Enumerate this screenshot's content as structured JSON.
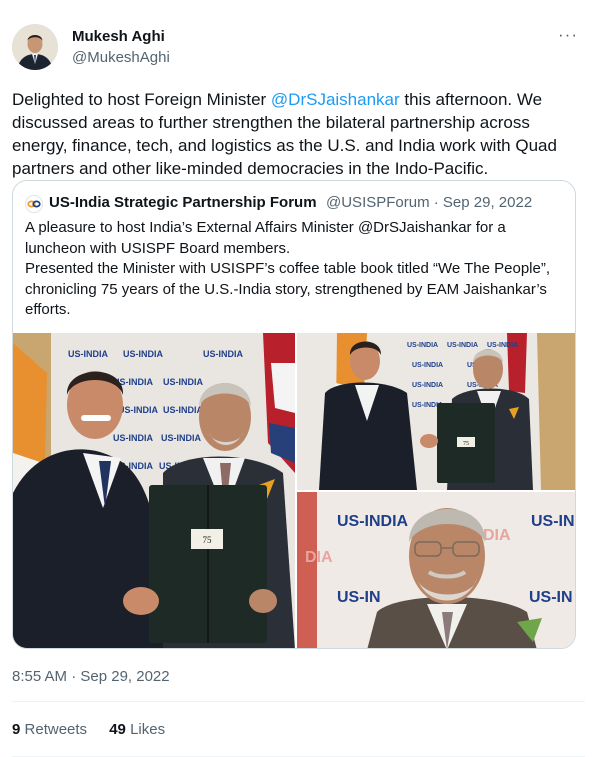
{
  "author": {
    "display_name": "Mukesh Aghi",
    "handle": "@MukeshAghi"
  },
  "menu": {
    "more_label": "···"
  },
  "tweet": {
    "text_before": "Delighted to host Foreign Minister ",
    "mention": "@DrSJaishankar",
    "text_after": " this afternoon. We discussed areas to further strengthen the bilateral partnership across energy, finance, tech, and logistics as the U.S. and India work with Quad partners and other like-minded democracies in the Indo-Pacific."
  },
  "quote": {
    "display_name": "US-India Strategic Partnership Forum",
    "meta": "@USISPForum · Sep 29, 2022",
    "line1": "A pleasure to host India’s External Affairs Minister @DrSJaishankar for a luncheon with USISPF Board members.",
    "line2": "Presented the Minister with USISPF’s coffee table book titled “We The People”, chronicling 75 years of the U.S.-India story, strengthened by EAM Jaishankar’s efforts.",
    "images": [
      {
        "backdrop_text": "US-INDIA",
        "book_label": "75"
      },
      {
        "backdrop_text": "US-INDIA",
        "book_label": "75"
      },
      {
        "backdrop_text": "US-INDIA"
      }
    ]
  },
  "timestamp": "8:55 AM · Sep 29, 2022",
  "stats": {
    "retweets_count": "9",
    "retweets_label": "Retweets",
    "likes_count": "49",
    "likes_label": "Likes"
  },
  "colors": {
    "accent": "#1d9bf0",
    "secondary_text": "#536471",
    "primary_text": "#0f1419",
    "border": "#cfd9de"
  }
}
